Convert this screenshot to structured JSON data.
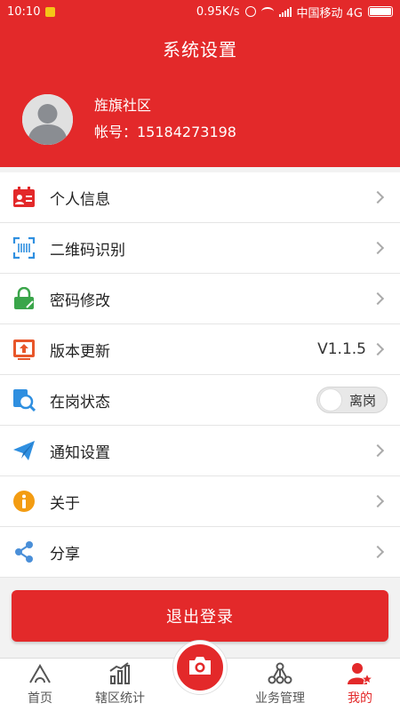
{
  "status_bar": {
    "time": "10:10",
    "network_speed": "0.95K/s",
    "carrier": "中国移动 4G"
  },
  "header": {
    "title": "系统设置",
    "community": "旌旗社区",
    "account": "帐号：15184273198"
  },
  "menu": {
    "items": [
      {
        "label": "个人信息",
        "icon": "id-card-icon"
      },
      {
        "label": "二维码识别",
        "icon": "qr-scan-icon"
      },
      {
        "label": "密码修改",
        "icon": "lock-icon"
      },
      {
        "label": "版本更新",
        "icon": "update-icon",
        "value": "V1.1.5"
      },
      {
        "label": "在岗状态",
        "icon": "search-status-icon",
        "toggle_label": "离岗"
      },
      {
        "label": "通知设置",
        "icon": "paper-plane-icon"
      },
      {
        "label": "关于",
        "icon": "info-icon"
      },
      {
        "label": "分享",
        "icon": "share-icon"
      }
    ]
  },
  "logout_label": "退出登录",
  "tabbar": {
    "tabs": [
      {
        "label": "首页",
        "icon": "home-icon"
      },
      {
        "label": "辖区统计",
        "icon": "stats-icon"
      },
      {
        "label": "",
        "icon": "camera-icon"
      },
      {
        "label": "业务管理",
        "icon": "network-icon"
      },
      {
        "label": "我的",
        "icon": "user-star-icon"
      }
    ]
  },
  "colors": {
    "primary": "#e3292a",
    "background": "#f2f2f2"
  }
}
